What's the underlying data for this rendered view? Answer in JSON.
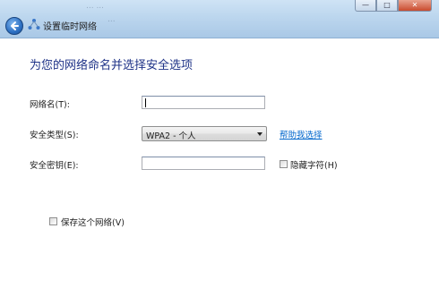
{
  "window": {
    "background_text_line1": "...  ...",
    "background_text_line2": "...",
    "minimize_glyph": "—",
    "maximize_glyph": "□",
    "close_glyph": "✕"
  },
  "header": {
    "title": "设置临时网络",
    "back_icon": "back-arrow-icon",
    "wizard_icon": "adhoc-network-icon"
  },
  "main": {
    "heading": "为您的网络命名并选择安全选项",
    "network_name": {
      "label": "网络名(T):",
      "value": ""
    },
    "security_type": {
      "label": "安全类型(S):",
      "selected": "WPA2 - 个人",
      "help_link": "帮助我选择"
    },
    "security_key": {
      "label": "安全密钥(E):",
      "value": "",
      "hide_chars_label": "隐藏字符(H)",
      "hide_chars_checked": false
    },
    "save_network": {
      "label": "保存这个网络(V)",
      "checked": false
    }
  },
  "colors": {
    "heading": "#1e3287",
    "link": "#0066cc",
    "titlebar": "#bcd6ee"
  }
}
